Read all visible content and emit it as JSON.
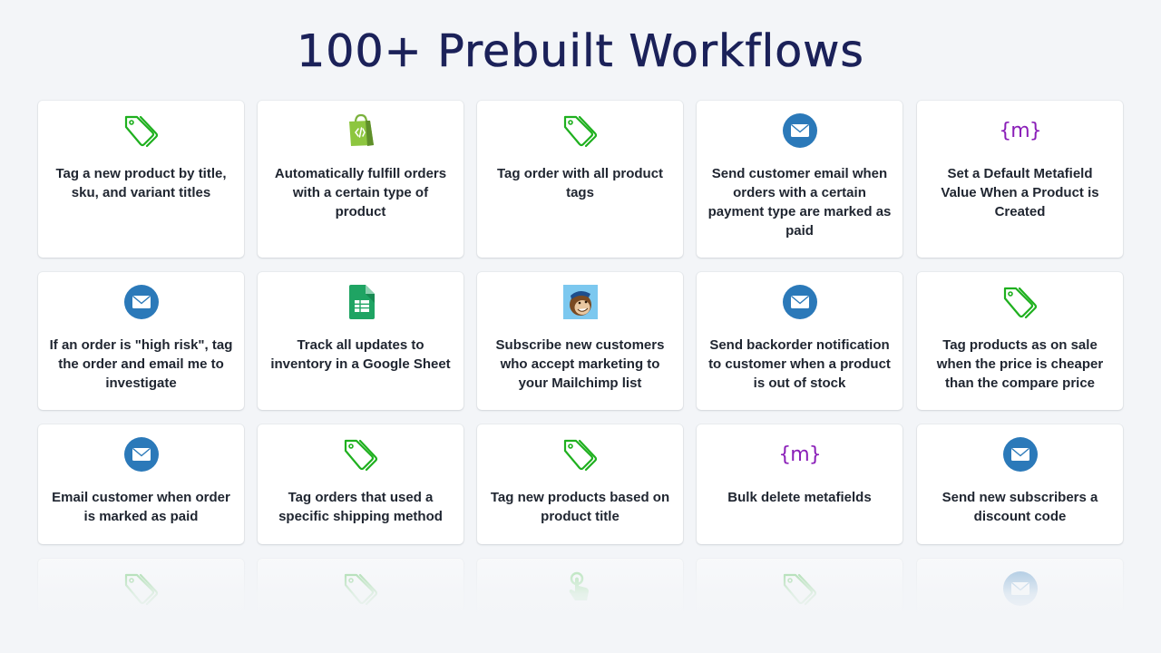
{
  "header": {
    "title": "100+ Prebuilt Workflows"
  },
  "colors": {
    "title": "#1b2159",
    "tag_green": "#1fb01f",
    "email_blue": "#2b79b9",
    "metafield_purple": "#8a1eb8",
    "background": "#f3f5f8"
  },
  "workflows": [
    {
      "icon": "tag-icon",
      "label": "Tag a new product by title, sku, and variant titles"
    },
    {
      "icon": "shopify-bag-icon",
      "label": "Automatically fulfill orders with a certain type of product"
    },
    {
      "icon": "tag-icon",
      "label": "Tag order with all product tags"
    },
    {
      "icon": "email-icon",
      "label": "Send customer email when orders with a certain payment type are marked as paid"
    },
    {
      "icon": "metafield-icon",
      "icon_text": "{m}",
      "label": "Set a Default Metafield Value When a Product is Created"
    },
    {
      "icon": "email-icon",
      "label": "If an order is \"high risk\", tag the order and email me to investigate"
    },
    {
      "icon": "google-sheets-icon",
      "label": "Track all updates to inventory in a Google Sheet"
    },
    {
      "icon": "mailchimp-icon",
      "label": "Subscribe new customers who accept marketing to your Mailchimp list"
    },
    {
      "icon": "email-icon",
      "label": "Send backorder notification to customer when a product is out of stock"
    },
    {
      "icon": "tag-icon",
      "label": "Tag products as on sale when the price is cheaper than the compare price"
    },
    {
      "icon": "email-icon",
      "label": "Email customer when order is marked as paid"
    },
    {
      "icon": "tag-icon",
      "label": "Tag orders that used a specific shipping method"
    },
    {
      "icon": "tag-icon",
      "label": "Tag new products based on product title"
    },
    {
      "icon": "metafield-icon",
      "icon_text": "{m}",
      "label": "Bulk delete metafields"
    },
    {
      "icon": "email-icon",
      "label": "Send new subscribers a discount code"
    },
    {
      "icon": "tag-icon",
      "label": ""
    },
    {
      "icon": "tag-icon",
      "label": ""
    },
    {
      "icon": "pointer-hand-icon",
      "label": ""
    },
    {
      "icon": "tag-icon",
      "label": ""
    },
    {
      "icon": "email-icon",
      "label": ""
    }
  ]
}
